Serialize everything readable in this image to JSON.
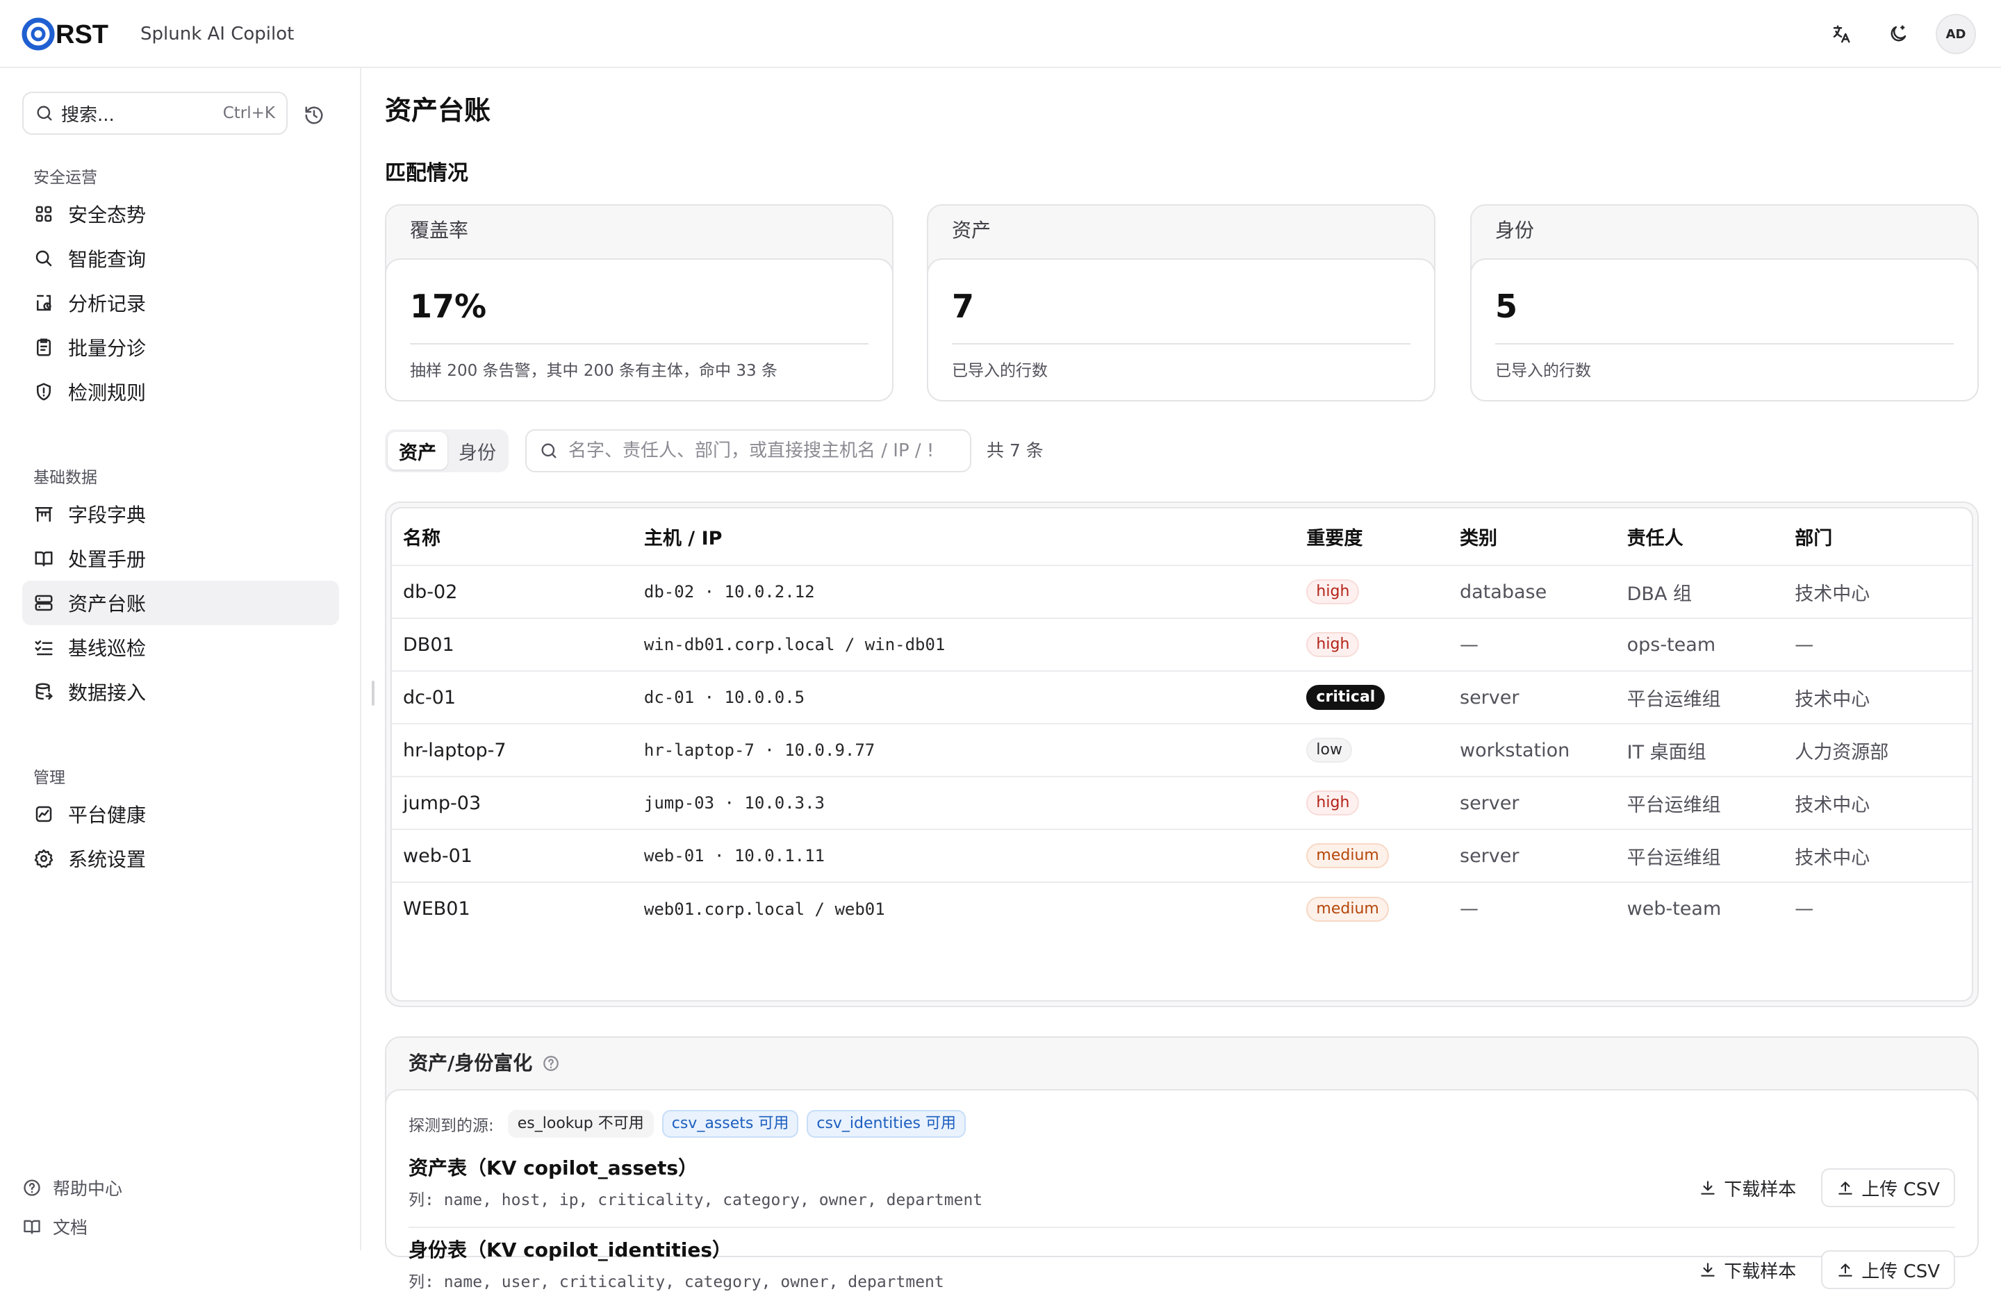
{
  "app": {
    "logo_text": "RST",
    "subtitle": "Splunk AI Copilot",
    "avatar_initials": "AD",
    "accent_color": "#1f5fd1"
  },
  "header": {
    "icons": [
      "translate-icon",
      "theme-toggle-icon"
    ]
  },
  "sidebar": {
    "search": {
      "placeholder": "搜索...",
      "shortcut": "Ctrl+K"
    },
    "sections": [
      {
        "title": "安全运营",
        "items": [
          {
            "label": "安全态势",
            "icon": "dashboard-icon"
          },
          {
            "label": "智能查询",
            "icon": "search-icon"
          },
          {
            "label": "分析记录",
            "icon": "history-record-icon"
          },
          {
            "label": "批量分诊",
            "icon": "clipboard-icon"
          },
          {
            "label": "检测规则",
            "icon": "shield-alert-icon"
          }
        ]
      },
      {
        "title": "基础数据",
        "items": [
          {
            "label": "字段字典",
            "icon": "dictionary-icon"
          },
          {
            "label": "处置手册",
            "icon": "book-icon"
          },
          {
            "label": "资产台账",
            "icon": "server-icon",
            "active": true
          },
          {
            "label": "基线巡检",
            "icon": "checklist-icon"
          },
          {
            "label": "数据接入",
            "icon": "database-import-icon"
          }
        ]
      },
      {
        "title": "管理",
        "items": [
          {
            "label": "平台健康",
            "icon": "health-chart-icon"
          },
          {
            "label": "系统设置",
            "icon": "gear-icon"
          }
        ]
      }
    ],
    "footer": [
      {
        "label": "帮助中心",
        "icon": "help-circle-icon"
      },
      {
        "label": "文档",
        "icon": "docs-book-icon"
      }
    ]
  },
  "main": {
    "page_title": "资产台账",
    "section_title": "匹配情况",
    "stats": [
      {
        "title": "覆盖率",
        "value": "17%",
        "note": "抽样 200 条告警，其中 200 条有主体，命中 33 条"
      },
      {
        "title": "资产",
        "value": "7",
        "note": "已导入的行数"
      },
      {
        "title": "身份",
        "value": "5",
        "note": "已导入的行数"
      }
    ],
    "tabs": [
      {
        "label": "资产",
        "active": true
      },
      {
        "label": "身份",
        "active": false
      }
    ],
    "table_search_placeholder": "名字、责任人、部门，或直接搜主机名 / IP / !",
    "count_text": "共 7 条",
    "table": {
      "columns": [
        "名称",
        "主机 / IP",
        "重要度",
        "类别",
        "责任人",
        "部门"
      ],
      "rows": [
        {
          "name": "db-02",
          "host": "db-02 · 10.0.2.12",
          "criticality": "high",
          "category": "database",
          "owner": "DBA 组",
          "department": "技术中心"
        },
        {
          "name": "DB01",
          "host": "win-db01.corp.local / win-db01",
          "criticality": "high",
          "category": "—",
          "owner": "ops-team",
          "department": "—"
        },
        {
          "name": "dc-01",
          "host": "dc-01 · 10.0.0.5",
          "criticality": "critical",
          "category": "server",
          "owner": "平台运维组",
          "department": "技术中心"
        },
        {
          "name": "hr-laptop-7",
          "host": "hr-laptop-7 · 10.0.9.77",
          "criticality": "low",
          "category": "workstation",
          "owner": "IT 桌面组",
          "department": "人力资源部"
        },
        {
          "name": "jump-03",
          "host": "jump-03 · 10.0.3.3",
          "criticality": "high",
          "category": "server",
          "owner": "平台运维组",
          "department": "技术中心"
        },
        {
          "name": "web-01",
          "host": "web-01 · 10.0.1.11",
          "criticality": "medium",
          "category": "server",
          "owner": "平台运维组",
          "department": "技术中心"
        },
        {
          "name": "WEB01",
          "host": "web01.corp.local / web01",
          "criticality": "medium",
          "category": "—",
          "owner": "web-team",
          "department": "—"
        }
      ]
    },
    "enrichment": {
      "title": "资产/身份富化",
      "sources_label": "探测到的源:",
      "sources": [
        {
          "label": "es_lookup 不可用",
          "status": "unavailable"
        },
        {
          "label": "csv_assets 可用",
          "status": "available"
        },
        {
          "label": "csv_identities 可用",
          "status": "available"
        }
      ],
      "tables": [
        {
          "title": "资产表（KV copilot_assets）",
          "columns": "列: name, host, ip, criticality, category, owner, department",
          "download_label": "下载样本",
          "upload_label": "上传 CSV"
        },
        {
          "title": "身份表（KV copilot_identities）",
          "columns": "列: name, user, criticality, category, owner, department",
          "download_label": "下载样本",
          "upload_label": "上传 CSV"
        }
      ]
    }
  }
}
